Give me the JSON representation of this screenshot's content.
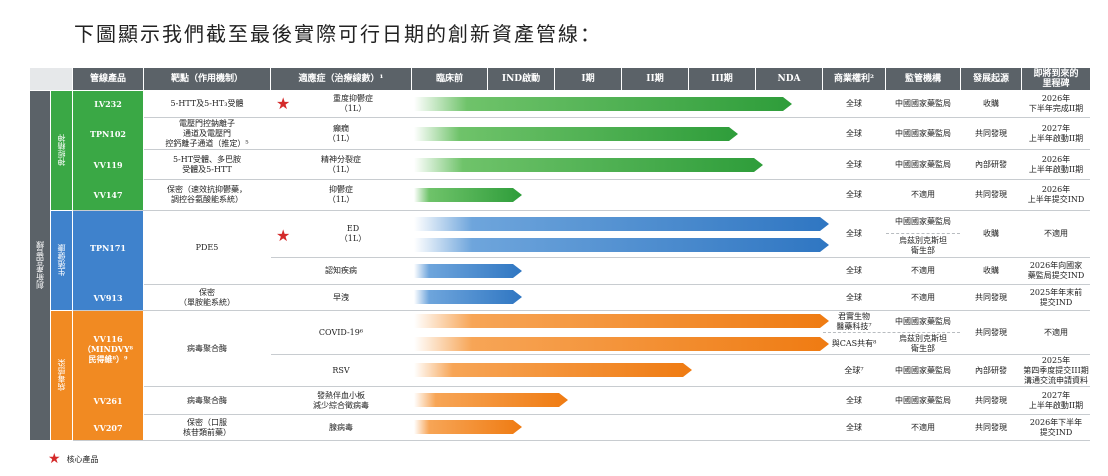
{
  "title": "下圖顯示我們截至最後實際可行日期的創新資產管線：",
  "headers": {
    "product": "管線產品",
    "target": "靶點（作用機制）",
    "indication": "適應症（治療線數）¹",
    "preclinical": "臨床前",
    "ind": "IND啟動",
    "phase1": "I期",
    "phase2": "II期",
    "phase3": "III期",
    "nda": "NDA",
    "rights": "商業權利²",
    "regulator": "監管機構",
    "origin": "發展起源",
    "milestone": "即將到來的\n里程碑"
  },
  "groups": {
    "outer": "創新產品管線",
    "neuro": "神經精神",
    "sexual": "生殖健康",
    "antiviral": "病毒感染"
  },
  "rows": [
    {
      "code": "LV232",
      "target": "5-HTT及5-HT₃受體",
      "indication": "重度抑鬱症\n（1L）",
      "rights": "全球",
      "regulator": "中國國家藥監局",
      "origin": "收購",
      "milestone": "2026年\n下半年完成II期",
      "stage": 0.91,
      "color": "green"
    },
    {
      "code": "TPN102",
      "target": "電壓門控鈉離子\n通道及電壓門\n控鈣離子通道（推定）⁵",
      "indication": "癲癇\n（1L）",
      "rights": "全球",
      "regulator": "中國國家藥監局",
      "origin": "共同發現",
      "milestone": "2027年\n上半年啟動II期",
      "stage": 0.78,
      "color": "green"
    },
    {
      "code": "VV119",
      "target": "5-HT受體、多巴胺\n受體及5-HTT",
      "indication": "精神分裂症\n（1L）",
      "rights": "全球",
      "regulator": "中國國家藥監局",
      "origin": "內部研發",
      "milestone": "2026年\n上半年啟動II期",
      "stage": 0.84,
      "color": "green"
    },
    {
      "code": "VV147",
      "target": "保密（速效抗抑鬱藥，\n調控谷氨酸能系統）",
      "indication": "抑鬱症\n（1L）",
      "rights": "全球",
      "regulator": "不適用",
      "origin": "共同發現",
      "milestone": "2026年\n上半年提交IND",
      "stage": 0.26,
      "color": "green"
    },
    {
      "code": "TPN171",
      "target": "PDE5",
      "indication": "ED\n（1L）",
      "rights": "全球",
      "regulator": "中國國家藥監局",
      "regulator2": "烏茲別克斯坦\n衛生部",
      "origin": "收購",
      "milestone": "不適用",
      "stage": 1.0,
      "color": "blue"
    },
    {
      "code": "",
      "target": "",
      "indication": "認知疾病",
      "rights": "全球",
      "regulator": "不適用",
      "origin": "收購",
      "milestone": "2026年向國家\n藥監局提交IND",
      "stage": 0.26,
      "color": "blue"
    },
    {
      "code": "VV913",
      "target": "保密\n（單胺能系統）",
      "indication": "早洩",
      "rights": "全球",
      "regulator": "不適用",
      "origin": "共同發現",
      "milestone": "2025年年末前\n提交IND",
      "stage": 0.26,
      "color": "blue"
    },
    {
      "code": "VV116\n（MINDVY⁸\n民得維⁸）⁹",
      "target": "病毒聚合酶",
      "indication": "COVID-19⁶",
      "rights": "君實生物\n醫藥科技⁷",
      "rights2": "與CAS共有⁸",
      "regulator": "中國國家藥監局",
      "regulator2": "烏茲別克斯坦\n衛生部",
      "origin": "共同發現",
      "milestone": "不適用",
      "stage": 1.0,
      "color": "orange"
    },
    {
      "code": "",
      "target": "",
      "indication": "RSV",
      "rights": "全球⁷",
      "regulator": "中國國家藥監局",
      "origin": "內部研發",
      "milestone": "2025年\n第四季度提交III期\n溝通交流申請資料",
      "stage": 0.67,
      "color": "orange"
    },
    {
      "code": "VV261",
      "target": "病毒聚合酶",
      "indication": "發熱伴血小板\n減少綜合徵病毒",
      "rights": "全球",
      "regulator": "中國國家藥監局",
      "origin": "共同發現",
      "milestone": "2027年\n上半年啟動II期",
      "stage": 0.37,
      "color": "orange"
    },
    {
      "code": "VV207",
      "target": "保密（口服\n核苷類前藥）",
      "indication": "腺病毒",
      "rights": "全球",
      "regulator": "不適用",
      "origin": "共同發現",
      "milestone": "2026年下半年\n提交IND",
      "stage": 0.26,
      "color": "orange"
    }
  ],
  "legend": "核心產品",
  "colors": {
    "green": "#3aa845",
    "blue": "#3f82cc",
    "orange": "#f18a22",
    "header": "#5b6268",
    "outer": "#5b6268"
  }
}
